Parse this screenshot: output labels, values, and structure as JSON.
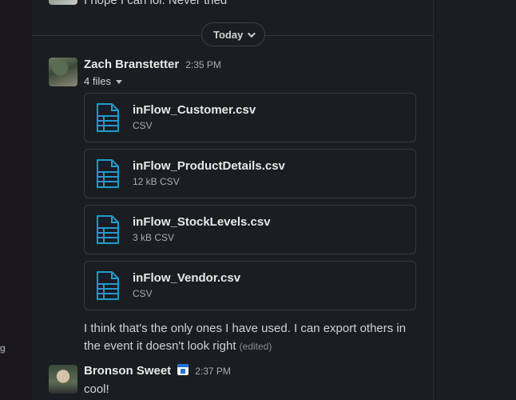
{
  "previous_message": {
    "text": "I hope I can lol. Never tried"
  },
  "day_divider": {
    "label": "Today"
  },
  "messages": [
    {
      "author": "Zach Branstetter",
      "time": "2:35 PM",
      "files_label": "4 files",
      "files": [
        {
          "name": "inFlow_Customer.csv",
          "meta": "CSV",
          "icon": "file-csv-icon"
        },
        {
          "name": "inFlow_ProductDetails.csv",
          "meta": "12 kB CSV",
          "icon": "file-csv-icon"
        },
        {
          "name": "inFlow_StockLevels.csv",
          "meta": "3 kB CSV",
          "icon": "file-csv-icon"
        },
        {
          "name": "inFlow_Vendor.csv",
          "meta": "CSV",
          "icon": "file-csv-icon"
        }
      ],
      "text_line1": "I think that's the only ones I have used. I can export others in",
      "text_line2": "the event it doesn't look right",
      "edited": "(edited)"
    },
    {
      "author": "Bronson Sweet",
      "status_icon": "calendar-icon",
      "time": "2:37 PM",
      "text": "cool!"
    }
  ],
  "left_strip": {
    "stub_text": "g"
  },
  "colors": {
    "background": "#1a1d21",
    "border": "#35373b",
    "file_icon": "#1d9bd1",
    "text": "#d1d2d3",
    "muted": "#ababad"
  }
}
